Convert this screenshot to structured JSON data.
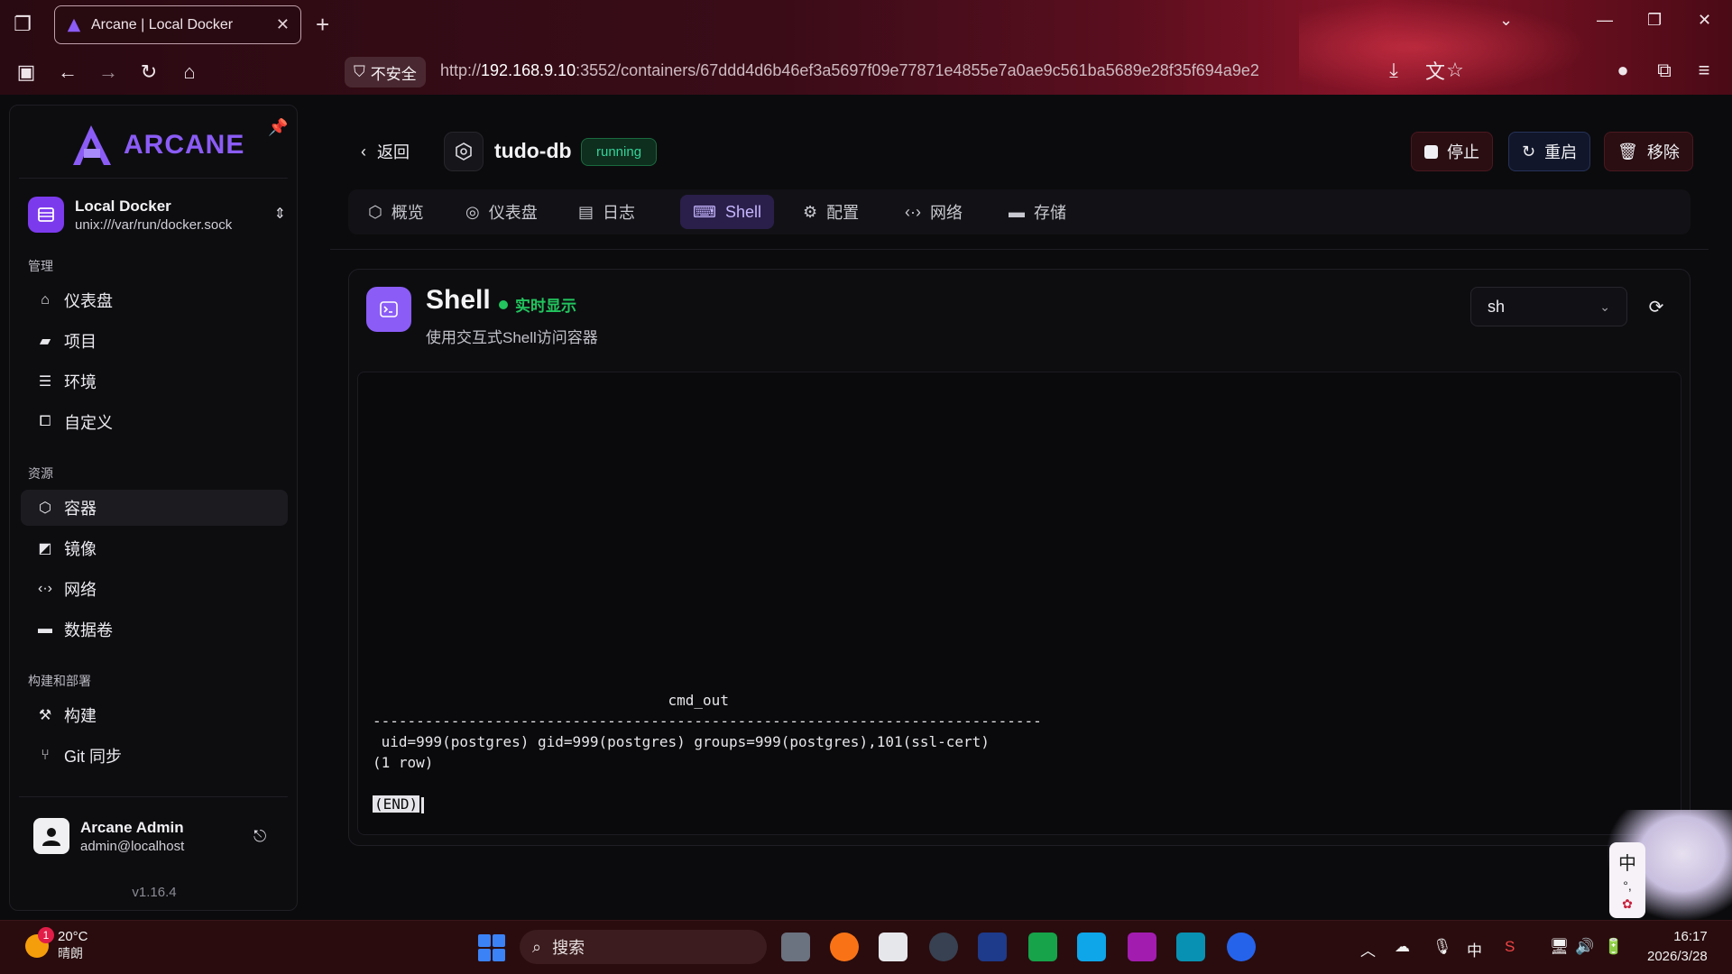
{
  "browser": {
    "tab_title": "Arcane | Local Docker",
    "security_label": "不安全",
    "url_prefix": "http://",
    "url_host": "192.168.9.10",
    "url_rest": ":3552/containers/67ddd4d6b46ef3a5697f09e77871e4855e7a0ae9c561ba5689e28f35f694a9e2"
  },
  "sidebar": {
    "brand": "ARCANE",
    "environment": {
      "name": "Local Docker",
      "socket": "unix:///var/run/docker.sock"
    },
    "sections": [
      {
        "label": "管理",
        "items": [
          {
            "label": "仪表盘",
            "icon": "home-icon"
          },
          {
            "label": "项目",
            "icon": "folder-icon"
          },
          {
            "label": "环境",
            "icon": "server-icon"
          },
          {
            "label": "自定义",
            "icon": "customize-icon"
          }
        ]
      },
      {
        "label": "资源",
        "items": [
          {
            "label": "容器",
            "icon": "container-icon",
            "active": true
          },
          {
            "label": "镜像",
            "icon": "image-icon"
          },
          {
            "label": "网络",
            "icon": "network-icon"
          },
          {
            "label": "数据卷",
            "icon": "volume-icon"
          }
        ]
      },
      {
        "label": "构建和部署",
        "items": [
          {
            "label": "构建",
            "icon": "hammer-icon"
          },
          {
            "label": "Git 同步",
            "icon": "git-icon"
          }
        ]
      }
    ],
    "user": {
      "name": "Arcane Admin",
      "email": "admin@localhost"
    },
    "version": "v1.16.4"
  },
  "header": {
    "back_label": "返回",
    "container_name": "tudo-db",
    "status": "running",
    "stop_label": "停止",
    "restart_label": "重启",
    "remove_label": "移除"
  },
  "tabs": [
    {
      "label": "概览",
      "icon": "overview-icon"
    },
    {
      "label": "仪表盘",
      "icon": "gauge-icon"
    },
    {
      "label": "日志",
      "icon": "file-icon"
    },
    {
      "label": "Shell",
      "icon": "terminal-icon",
      "active": true
    },
    {
      "label": "配置",
      "icon": "gear-icon"
    },
    {
      "label": "网络",
      "icon": "network-icon"
    },
    {
      "label": "存储",
      "icon": "storage-icon"
    }
  ],
  "shell": {
    "title": "Shell",
    "live_label": "实时显示",
    "subtitle": "使用交互式Shell访问容器",
    "shell_type": "sh",
    "terminal": {
      "header": "                                  cmd_out",
      "rule": "-----------------------------------------------------------------------------",
      "row": " uid=999(postgres) gid=999(postgres) groups=999(postgres),101(ssl-cert)",
      "count": "(1 row)",
      "end": "(END)"
    }
  },
  "taskbar": {
    "weather_temp": "20°C",
    "weather_cond": "晴朗",
    "weather_badge": "1",
    "search_label": "搜索",
    "ime": "中",
    "time": "16:17",
    "date": "2026/3/28"
  },
  "ime_widget": {
    "char": "中"
  },
  "colors": {
    "accent": "#8b5cf6",
    "running": "#34d399",
    "live": "#22c55e"
  }
}
